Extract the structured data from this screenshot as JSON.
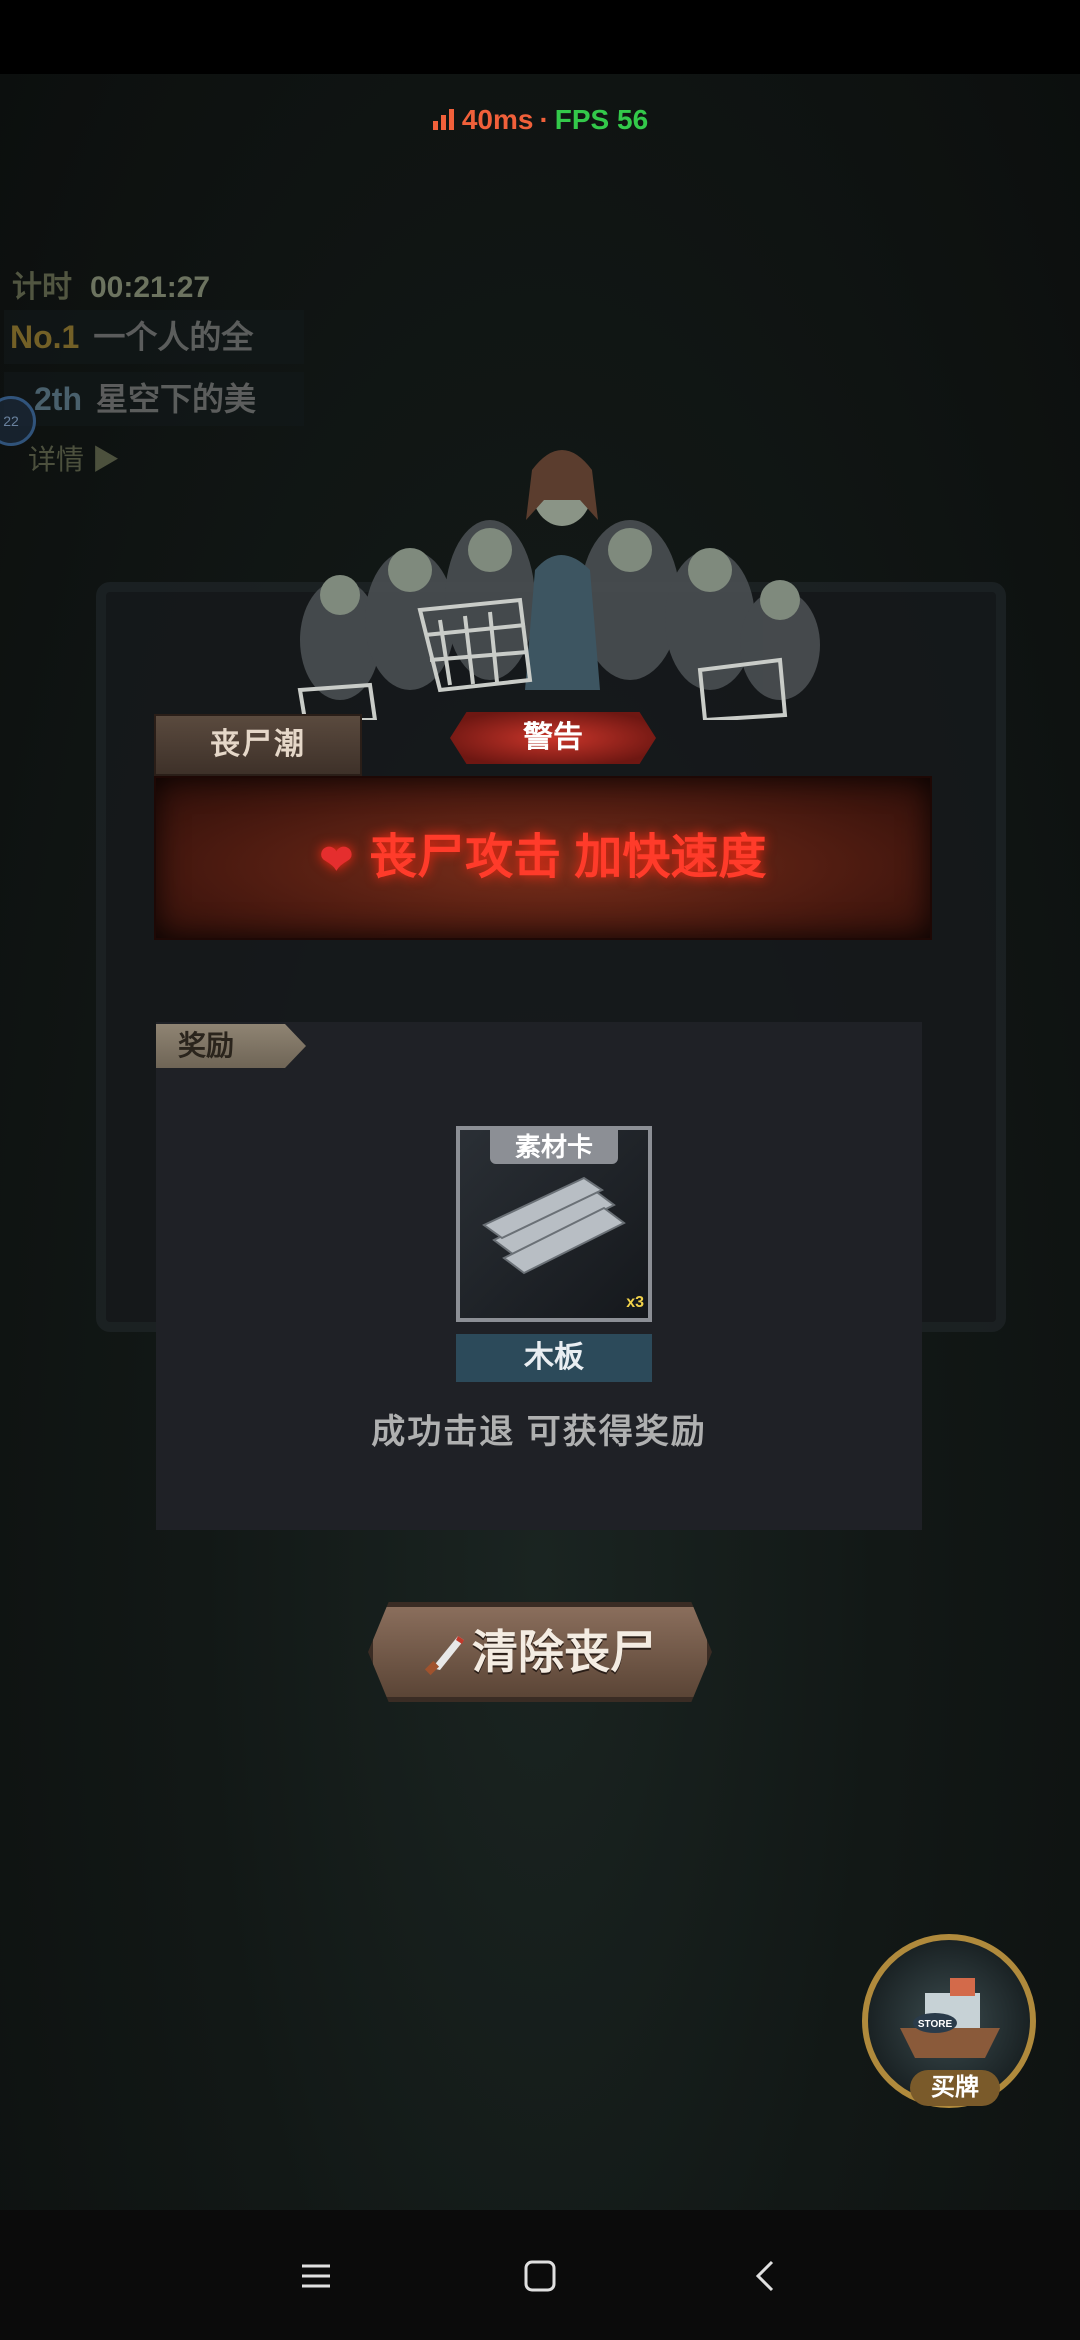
{
  "net": {
    "ping": "40ms",
    "separator": "·",
    "fps": "FPS 56"
  },
  "hud": {
    "timer_label": "计时",
    "timer_value": "00:21:27",
    "rank1": {
      "rank": "No.1",
      "name": "一个人的全"
    },
    "rank2": {
      "rank": "2th",
      "name": "星空下的美"
    },
    "avatar_level": "22",
    "detail_label": "详情 ▶"
  },
  "modal": {
    "tag_left": "丧尸潮",
    "tag_center": "警告",
    "banner_text": "丧尸攻击 加快速度",
    "reward_tag": "奖励",
    "card": {
      "label": "素材卡",
      "corner": "x3",
      "quantity": "木板"
    },
    "reward_note": "成功击退   可获得奖励"
  },
  "action_button": {
    "label": "清除丧尸"
  },
  "store": {
    "badge": "STORE",
    "label": "买牌"
  },
  "colors": {
    "ping": "#f0603a",
    "fps": "#33c94a",
    "banner_text": "#ff3b2a",
    "accent_gold": "#b08a3c"
  },
  "icons": {
    "signal": "signal-bars-icon",
    "heart": "heart-icon",
    "knife": "knife-icon",
    "menu": "menu-icon",
    "home": "home-icon",
    "back": "back-icon"
  }
}
